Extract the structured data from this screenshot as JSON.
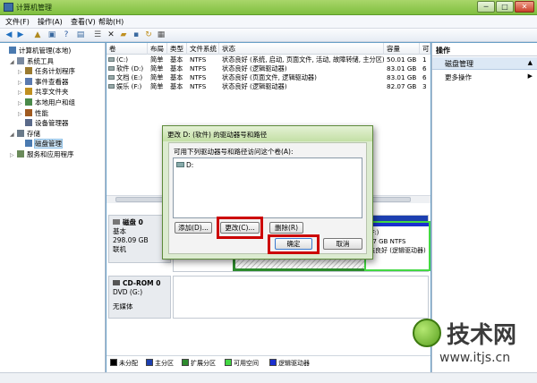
{
  "window": {
    "title": "计算机管理",
    "min": "─",
    "max": "□",
    "close": "✕"
  },
  "menu": [
    "文件(F)",
    "操作(A)",
    "查看(V)",
    "帮助(H)"
  ],
  "toolbar_icons": [
    "back-icon",
    "forward-icon",
    "up-icon",
    "console-icon",
    "help-icon",
    "properties-icon",
    "list-icon",
    "delete-icon",
    "open-icon",
    "save-icon",
    "refresh-icon",
    "settings-icon"
  ],
  "tree": [
    {
      "label": "计算机管理(本地)",
      "indent": 0,
      "twisty": ""
    },
    {
      "label": "系统工具",
      "indent": 1,
      "twisty": "◢"
    },
    {
      "label": "任务计划程序",
      "indent": 2,
      "twisty": "▷"
    },
    {
      "label": "事件查看器",
      "indent": 2,
      "twisty": "▷"
    },
    {
      "label": "共享文件夹",
      "indent": 2,
      "twisty": "▷"
    },
    {
      "label": "本地用户和组",
      "indent": 2,
      "twisty": "▷"
    },
    {
      "label": "性能",
      "indent": 2,
      "twisty": "▷"
    },
    {
      "label": "设备管理器",
      "indent": 2,
      "twisty": ""
    },
    {
      "label": "存储",
      "indent": 1,
      "twisty": "◢"
    },
    {
      "label": "磁盘管理",
      "indent": 2,
      "twisty": "",
      "selected": true
    },
    {
      "label": "服务和应用程序",
      "indent": 1,
      "twisty": "▷"
    }
  ],
  "volumes": {
    "headers": [
      "卷",
      "布局",
      "类型",
      "文件系统",
      "状态",
      "容量",
      "可"
    ],
    "rows": [
      [
        "(C:)",
        "简单",
        "基本",
        "NTFS",
        "状态良好 (系统, 启动, 页面文件, 活动, 故障转储, 主分区)",
        "50.01 GB",
        "1"
      ],
      [
        "软件 (D:)",
        "简单",
        "基本",
        "NTFS",
        "状态良好 (逻辑驱动器)",
        "83.01 GB",
        "6"
      ],
      [
        "文档 (E:)",
        "简单",
        "基本",
        "NTFS",
        "状态良好 (页面文件, 逻辑驱动器)",
        "83.01 GB",
        "6"
      ],
      [
        "娱乐 (F:)",
        "简单",
        "基本",
        "NTFS",
        "状态良好 (逻辑驱动器)",
        "82.07 GB",
        "3"
      ]
    ]
  },
  "disk0": {
    "name": "磁盘 0",
    "type": "基本",
    "size": "298.09 GB",
    "status": "联机",
    "partF": {
      "name": "(F:)",
      "size": "07 GB NTFS",
      "status": "态良好 (逻辑驱动器)"
    }
  },
  "cdrom": {
    "name": "CD-ROM 0",
    "type": "DVD (G:)",
    "status": "无媒体"
  },
  "legend": [
    {
      "label": "未分配",
      "color": "#000000"
    },
    {
      "label": "主分区",
      "color": "#1c3fb0"
    },
    {
      "label": "扩展分区",
      "color": "#2e8b2e"
    },
    {
      "label": "可用空间",
      "color": "#43d843"
    },
    {
      "label": "逻辑驱动器",
      "color": "#1a2fd0"
    }
  ],
  "actions": {
    "header": "操作",
    "section": "磁盘管理",
    "more": "更多操作"
  },
  "dialog": {
    "title": "更改 D: (软件) 的驱动器号和路径",
    "prompt": "可用下列驱动器号和路径访问这个卷(A):",
    "item": "D:",
    "add": "添加(D)...",
    "change": "更改(C)...",
    "remove": "删除(R)",
    "ok": "确定",
    "cancel": "取消"
  },
  "watermark": {
    "brand": "技术网",
    "url": "www.itjs.cn"
  }
}
